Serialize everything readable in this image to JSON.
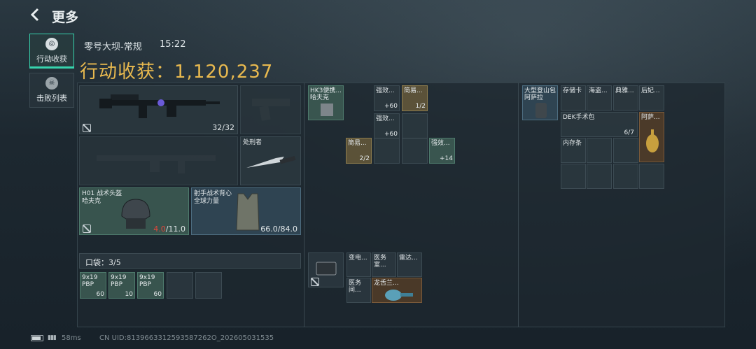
{
  "header": {
    "back_icon": "back-arrow-icon",
    "title": "更多"
  },
  "tabs": [
    {
      "label": "行动收获",
      "icon": "yield-icon",
      "active": true
    },
    {
      "label": "击败列表",
      "icon": "skull-icon",
      "active": false
    }
  ],
  "raid": {
    "map": "零号大坝-常规",
    "time": "15:22",
    "yield_label": "行动收获：",
    "yield_value": "1,120,237"
  },
  "loadout": {
    "primary": {
      "ammo": "32/32"
    },
    "melee": {
      "name": "处刑者"
    },
    "helmet": {
      "name": "H01 战术头盔",
      "sub": "哈夫克",
      "dur_cur": "4.0",
      "dur_max": "/11.0"
    },
    "armor": {
      "name": "射手战术背心",
      "sub": "全球力量",
      "dur": "66.0/84.0"
    },
    "pocket": {
      "label": "口袋：",
      "count": "3/5",
      "items": [
        {
          "name": "9x19",
          "sub": "PBP",
          "count": "60"
        },
        {
          "name": "9x19",
          "sub": "PBP",
          "count": "10"
        },
        {
          "name": "9x19",
          "sub": "PBP",
          "count": "60"
        }
      ]
    }
  },
  "rig": {
    "name": "HK3便携...",
    "sub": "哈夫克",
    "items": [
      {
        "name": "强效...",
        "count": "+60"
      },
      {
        "name": "简易...",
        "count": "1/2"
      },
      {
        "name": "强效...",
        "count": "+60"
      },
      {
        "name": "简易...",
        "count": "2/2"
      },
      {
        "name": "强效...",
        "count": "+14"
      }
    ]
  },
  "safebox": {
    "items": [
      {
        "name": "变电..."
      },
      {
        "name": "医务室..."
      },
      {
        "name": "雷达..."
      },
      {
        "name": "医务间..."
      },
      {
        "name": "龙舌兰..."
      }
    ]
  },
  "backpack": {
    "name": "大型登山包",
    "sub": "阿萨拉",
    "items": [
      {
        "name": "存储卡"
      },
      {
        "name": "海盗..."
      },
      {
        "name": "典雅..."
      },
      {
        "name": "后妃..."
      },
      {
        "name": "DEK手术包",
        "count": "6/7"
      },
      {
        "name": "阿萨..."
      },
      {
        "name": "内存条"
      }
    ]
  },
  "status": {
    "ping": "58ms",
    "uid": "CN UID:8139663312593587262O_202605031535"
  }
}
